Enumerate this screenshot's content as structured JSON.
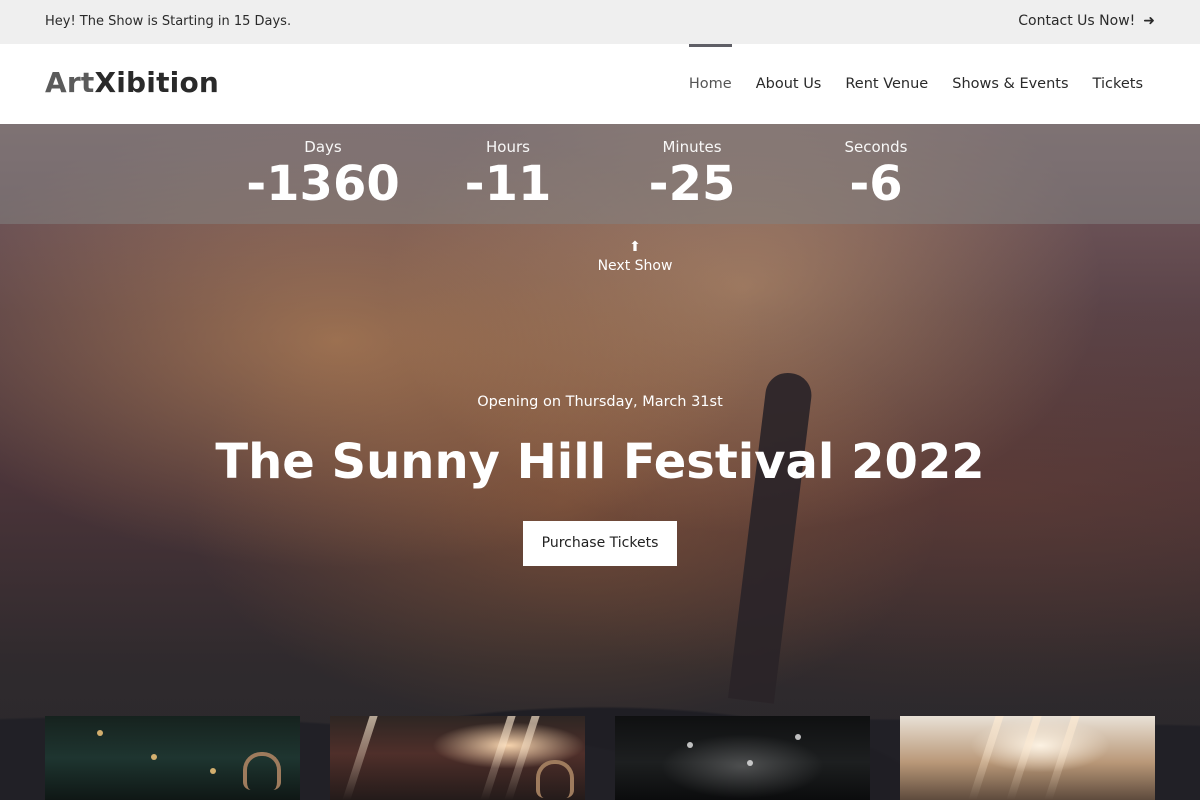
{
  "topbar": {
    "announcement": "Hey! The Show is Starting in 15 Days.",
    "contact_label": "Contact Us Now!",
    "contact_icon": "arrow-right-icon"
  },
  "header": {
    "logo_part1": "Art",
    "logo_part2": "Xibition",
    "nav": [
      "Home",
      "About Us",
      "Rent Venue",
      "Shows & Events",
      "Tickets"
    ]
  },
  "countdown": {
    "days_label": "Days",
    "days_value": "-1360",
    "hours_label": "Hours",
    "hours_value": "-11",
    "minutes_label": "Minutes",
    "minutes_value": "-25",
    "seconds_label": "Seconds",
    "seconds_value": "-6"
  },
  "hero": {
    "next_show_label": "Next Show",
    "opening_text": "Opening on Thursday, March 31st",
    "title": "The Sunny Hill Festival 2022",
    "cta_label": "Purchase Tickets",
    "next_icon": "arrow-up-icon"
  },
  "colors": {
    "topbar_bg": "#efefef",
    "header_bg": "#ffffff",
    "accent": "#5f5f66",
    "text_dark": "#2a2a2a"
  }
}
